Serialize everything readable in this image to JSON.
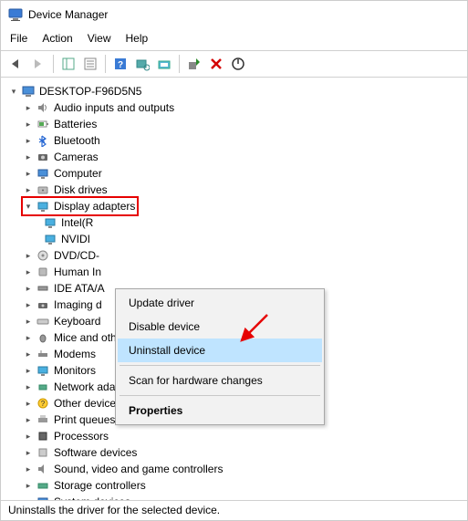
{
  "window": {
    "title": "Device Manager"
  },
  "menu": {
    "file": "File",
    "action": "Action",
    "view": "View",
    "help": "Help"
  },
  "tree": {
    "root": "DESKTOP-F96D5N5",
    "items": [
      "Audio inputs and outputs",
      "Batteries",
      "Bluetooth",
      "Cameras",
      "Computer",
      "Disk drives",
      "Display adapters",
      "DVD/CD-",
      "Human In",
      "IDE ATA/A",
      "Imaging d",
      "Keyboard",
      "Mice and other pointing devices",
      "Modems",
      "Monitors",
      "Network adapters",
      "Other devices",
      "Print queues",
      "Processors",
      "Software devices",
      "Sound, video and game controllers",
      "Storage controllers",
      "System devices"
    ],
    "children": {
      "display": [
        "Intel(R",
        "NVIDI"
      ]
    }
  },
  "context_menu": {
    "update": "Update driver",
    "disable": "Disable device",
    "uninstall": "Uninstall device",
    "scan": "Scan for hardware changes",
    "properties": "Properties"
  },
  "status": "Uninstalls the driver for the selected device."
}
